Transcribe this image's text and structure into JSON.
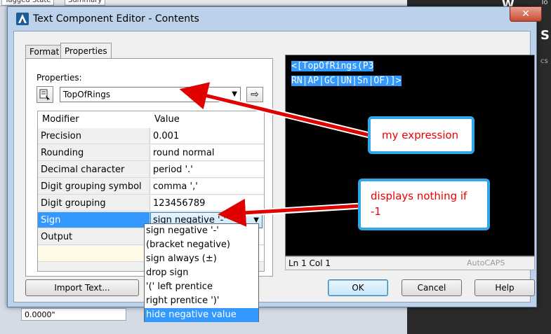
{
  "background": {
    "tab_labels": [
      "Tagged State",
      "Summary"
    ],
    "field_value": "0.0000\"",
    "right_letters": [
      "W",
      "S"
    ],
    "right_small": [
      "To",
      "cs"
    ]
  },
  "dialog": {
    "title": "Text Component Editor - Contents",
    "close_label": "✕",
    "tabs": [
      {
        "label": "Format",
        "active": false
      },
      {
        "label": "Properties",
        "active": true
      }
    ],
    "properties_label": "Properties:",
    "property_value": "TopOfRings",
    "grid": {
      "headers": [
        "Modifier",
        "Value"
      ],
      "rows": [
        {
          "modifier": "Precision",
          "value": "0.001"
        },
        {
          "modifier": "Rounding",
          "value": "round normal"
        },
        {
          "modifier": "Decimal character",
          "value": "period '.'"
        },
        {
          "modifier": "Digit grouping symbol",
          "value": "comma ','"
        },
        {
          "modifier": "Digit grouping",
          "value": "123456789"
        },
        {
          "modifier": "Sign",
          "value": "sign negative '-'"
        },
        {
          "modifier": "Output",
          "value": ""
        }
      ]
    },
    "sign_options": [
      "sign negative '-'",
      "(bracket negative)",
      "sign always (±)",
      "drop sign",
      "'(' left prentice",
      "right  prentice ')'",
      "hide negative value"
    ],
    "sign_highlighted": "hide negative value",
    "expression_lines": [
      "<[TopOfRings(P3",
      "RN|AP|GC|UN|Sn|OF)]>"
    ],
    "status_position": "Ln 1 Col 1",
    "status_brand": "AutoCAPS",
    "buttons": {
      "import": "Import Text...",
      "ok": "OK",
      "cancel": "Cancel",
      "help": "Help"
    }
  },
  "annotations": {
    "callout_1": "my expression",
    "callout_2_line1": "displays nothing if",
    "callout_2_line2": "-1",
    "color": "#e00000",
    "border_color": "#2fa7e8"
  }
}
